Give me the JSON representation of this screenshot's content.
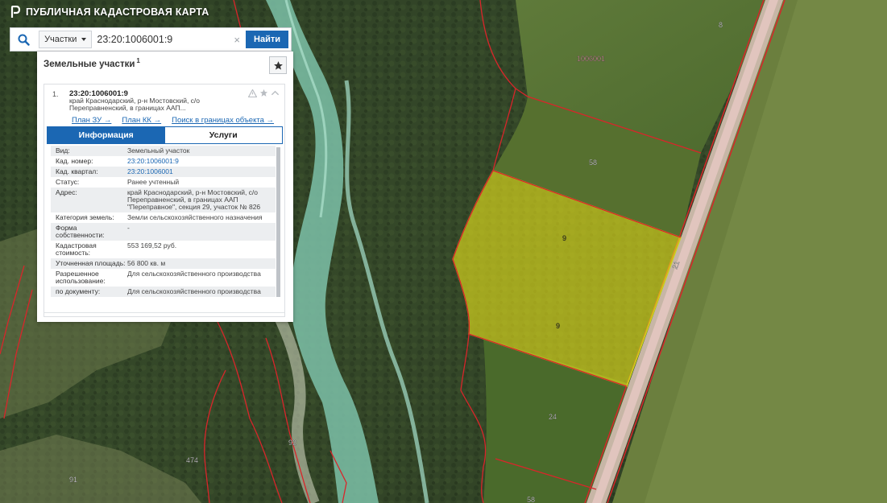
{
  "app": {
    "title": "ПУБЛИЧНАЯ КАДАСТРОВАЯ КАРТА"
  },
  "search": {
    "type_label": "Участки",
    "value": "23:20:1006001:9",
    "clear_symbol": "×",
    "button_label": "Найти"
  },
  "results": {
    "header": "Земельные участки",
    "count": "1",
    "item": {
      "index": "1.",
      "cadastral_number": "23:20:1006001:9",
      "address_short": "край Краснодарский, р-н Мостовский, с/о Переправненский, в границах ААП...",
      "links": [
        "План ЗУ →",
        "План КК →",
        "Поиск в границах объекта →"
      ],
      "tabs": [
        "Информация",
        "Услуги"
      ],
      "rows": [
        {
          "k": "Вид:",
          "v": "Земельный участок"
        },
        {
          "k": "Кад. номер:",
          "v": "23:20:1006001:9"
        },
        {
          "k": "Кад. квартал:",
          "v": "23:20:1006001"
        },
        {
          "k": "Статус:",
          "v": "Ранее учтенный"
        },
        {
          "k": "Адрес:",
          "v": "край Краснодарский, р-н Мостовский, с/о Переправненский, в границах ААП \"Переправное\", секция 29, участок № 826"
        },
        {
          "k": "Категория земель:",
          "v": "Земли сельскохозяйственного назначения"
        },
        {
          "k": "Форма собственности:",
          "v": "-"
        },
        {
          "k": "Кадастровая стоимость:",
          "v": "553 169,52 руб."
        },
        {
          "k": "Уточненная площадь:",
          "v": "56 800 кв. м"
        },
        {
          "k": "Разрешенное использование:",
          "v": "Для сельскохозяйственного производства"
        },
        {
          "k": "по документу:",
          "v": "Для сельскохозяйственного производства"
        }
      ]
    }
  },
  "map_labels": [
    "8",
    "1006001",
    "58",
    "9",
    "9",
    "24",
    "58",
    "92",
    "474",
    "91",
    "21"
  ],
  "colors": {
    "accent": "#1b67b3",
    "parcel_border": "#d9252a",
    "selected_fill": "#e6e21c"
  }
}
